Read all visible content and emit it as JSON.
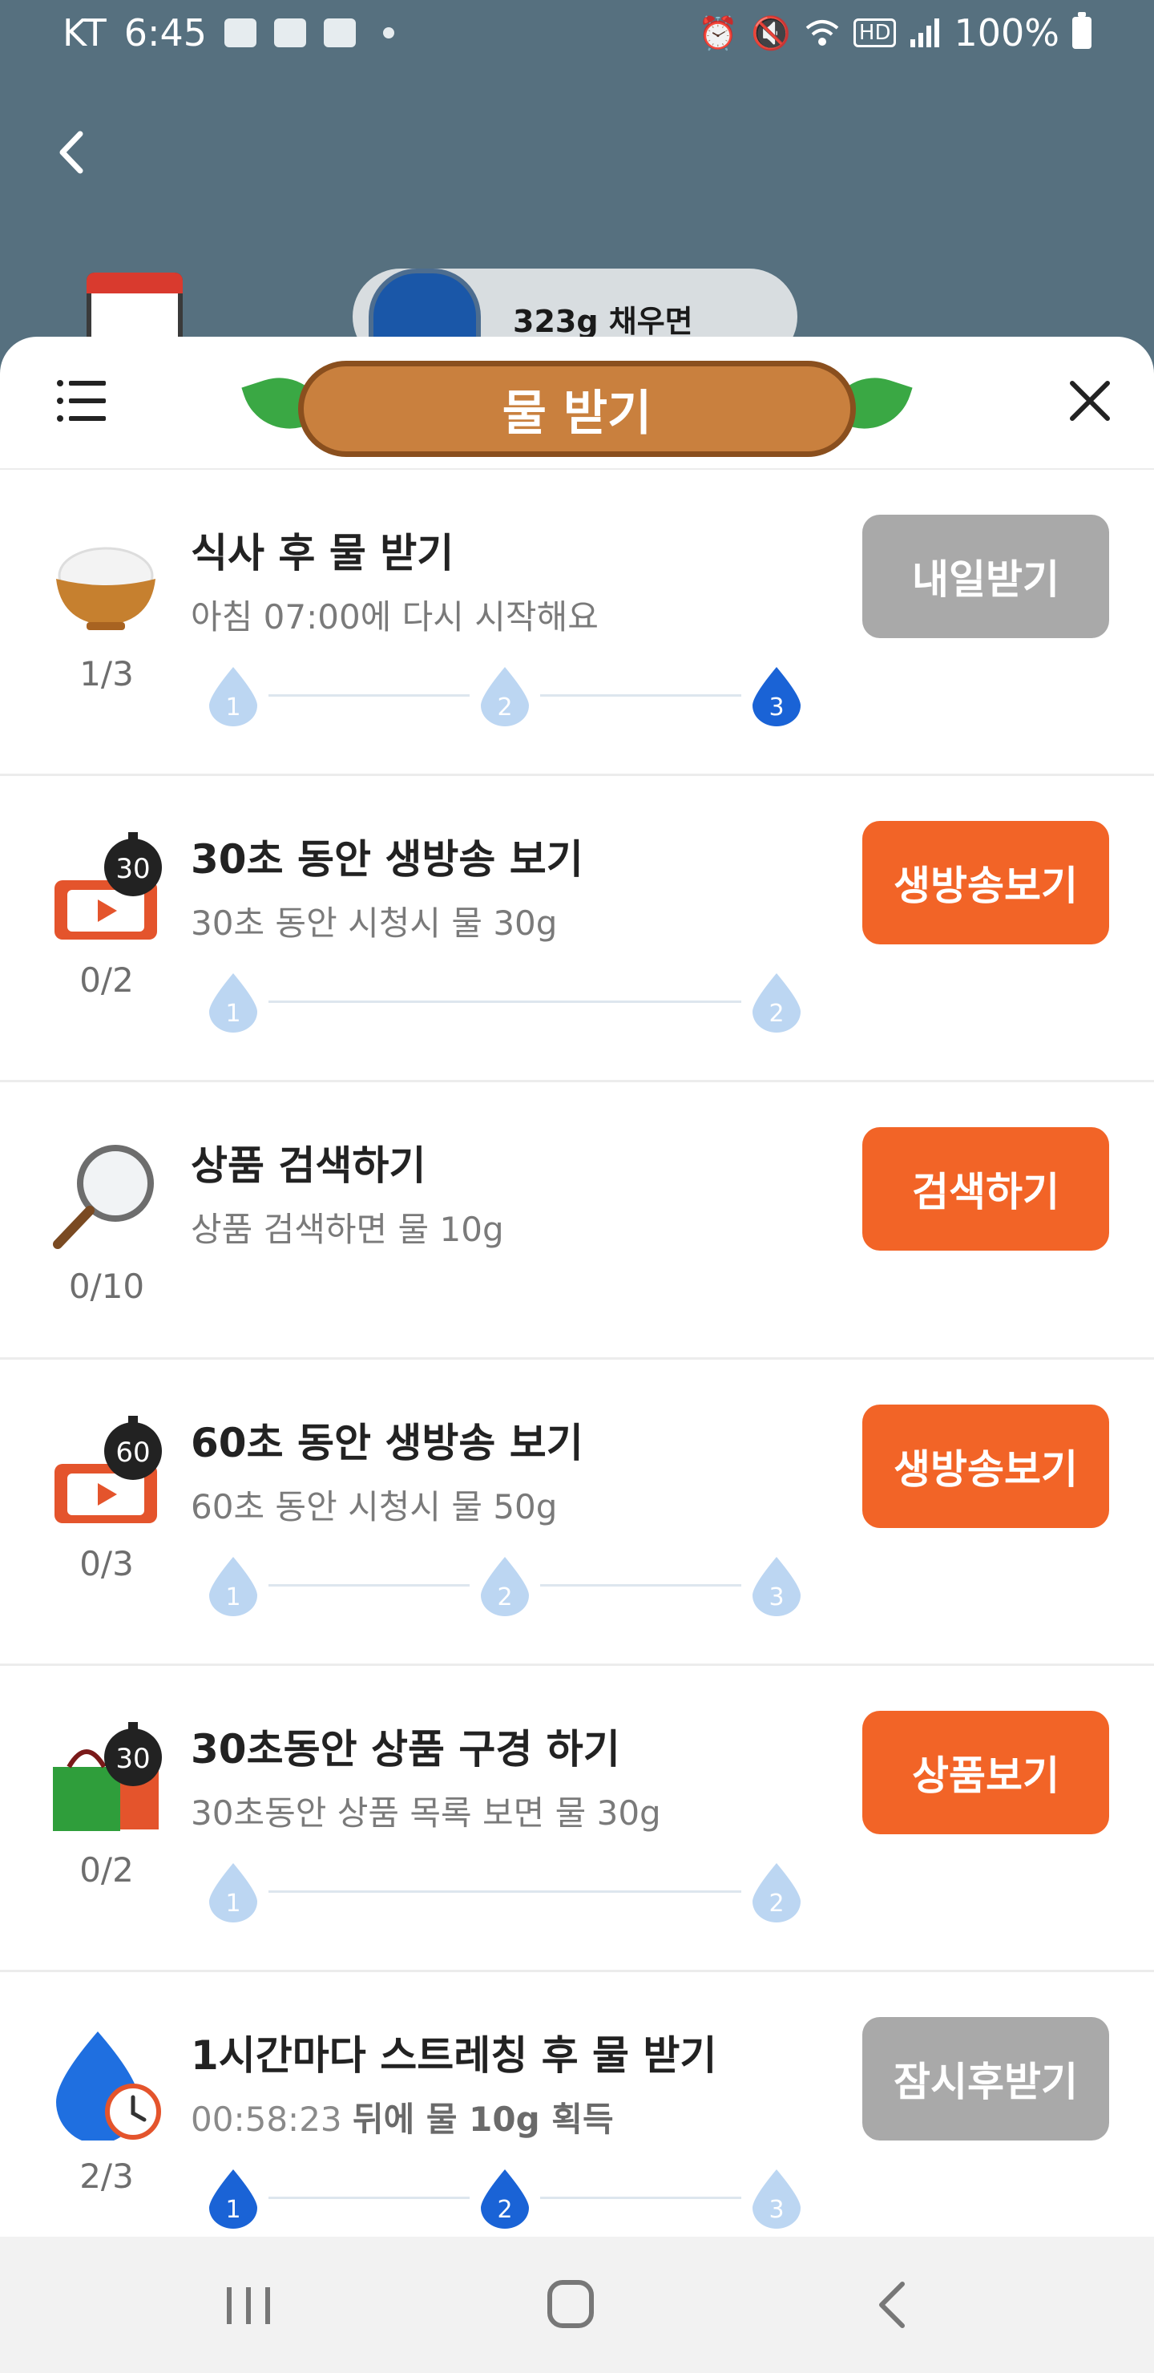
{
  "status_bar": {
    "carrier": "KT",
    "time": "6:45",
    "battery": "100%",
    "hd": "HD"
  },
  "behind": {
    "water_prompt": "323g 채우면"
  },
  "sheet": {
    "title": "물 받기"
  },
  "tasks": [
    {
      "title": "식사 후 물 받기",
      "subtitle": "아침 07:00에 다시 시작해요",
      "count": "1/3",
      "button": "내일받기",
      "button_style": "gray",
      "drops": [
        {
          "label": "1",
          "filled": false
        },
        {
          "label": "2",
          "filled": false
        },
        {
          "label": "3",
          "filled": true
        }
      ]
    },
    {
      "title": "30초 동안 생방송 보기",
      "subtitle": "30초 동안 시청시 물 30g",
      "count": "0/2",
      "button": "생방송보기",
      "button_style": "orange",
      "badge": "30",
      "drops": [
        {
          "label": "1",
          "filled": false
        },
        {
          "label": "2",
          "filled": false
        }
      ]
    },
    {
      "title": "상품 검색하기",
      "subtitle": "상품 검색하면 물 10g",
      "count": "0/10",
      "button": "검색하기",
      "button_style": "orange",
      "drops": []
    },
    {
      "title": "60초 동안 생방송 보기",
      "subtitle": "60초 동안 시청시 물 50g",
      "count": "0/3",
      "button": "생방송보기",
      "button_style": "orange",
      "badge": "60",
      "drops": [
        {
          "label": "1",
          "filled": false
        },
        {
          "label": "2",
          "filled": false
        },
        {
          "label": "3",
          "filled": false
        }
      ]
    },
    {
      "title": "30초동안 상품 구경 하기",
      "subtitle": "30초동안 상품 목록 보면 물 30g",
      "count": "0/2",
      "button": "상품보기",
      "button_style": "orange",
      "badge": "30",
      "drops": [
        {
          "label": "1",
          "filled": false
        },
        {
          "label": "2",
          "filled": false
        }
      ]
    },
    {
      "title": "1시간마다 스트레칭 후 물 받기",
      "timer": "00:58:23",
      "subtitle_rest": "뒤에 물 10g 획득",
      "count": "2/3",
      "button": "잠시후받기",
      "button_style": "gray",
      "drops": [
        {
          "label": "1",
          "filled": true
        },
        {
          "label": "2",
          "filled": true
        },
        {
          "label": "3",
          "filled": false
        }
      ]
    }
  ],
  "colors": {
    "accent_orange": "#f26427",
    "disabled_gray": "#a9a9a9",
    "drop_blue": "#1a63d6",
    "drop_light": "#bcd6f2"
  }
}
